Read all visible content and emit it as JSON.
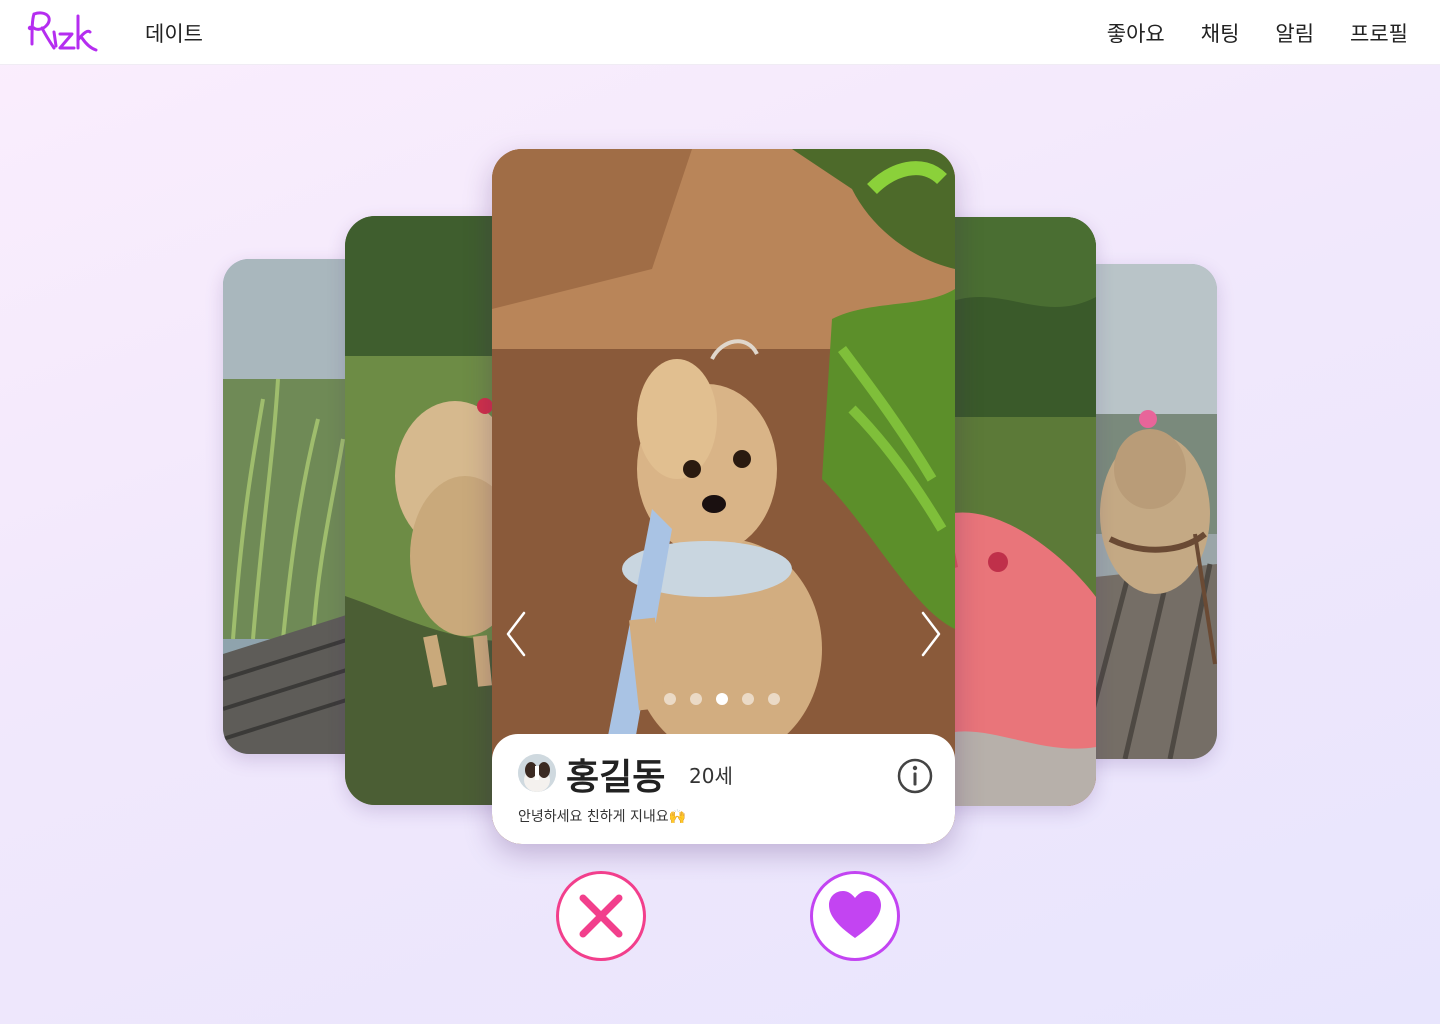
{
  "header": {
    "logo_text": "Rizk",
    "date_label": "데이트",
    "nav": [
      {
        "label": "좋아요"
      },
      {
        "label": "채팅"
      },
      {
        "label": "알림"
      },
      {
        "label": "프로필"
      }
    ]
  },
  "profile": {
    "name": "홍길동",
    "age": "20세",
    "bio": "안녕하세요 친하게 지내요🙌",
    "photo_count": 5,
    "active_photo_index": 2
  },
  "icons": {
    "prev": "chevron-left-icon",
    "next": "chevron-right-icon",
    "info": "info-icon",
    "pass": "close-icon",
    "like": "heart-icon"
  },
  "colors": {
    "brand": "#b52df0",
    "pass": "#f23f8c",
    "like": "#c344f2"
  }
}
